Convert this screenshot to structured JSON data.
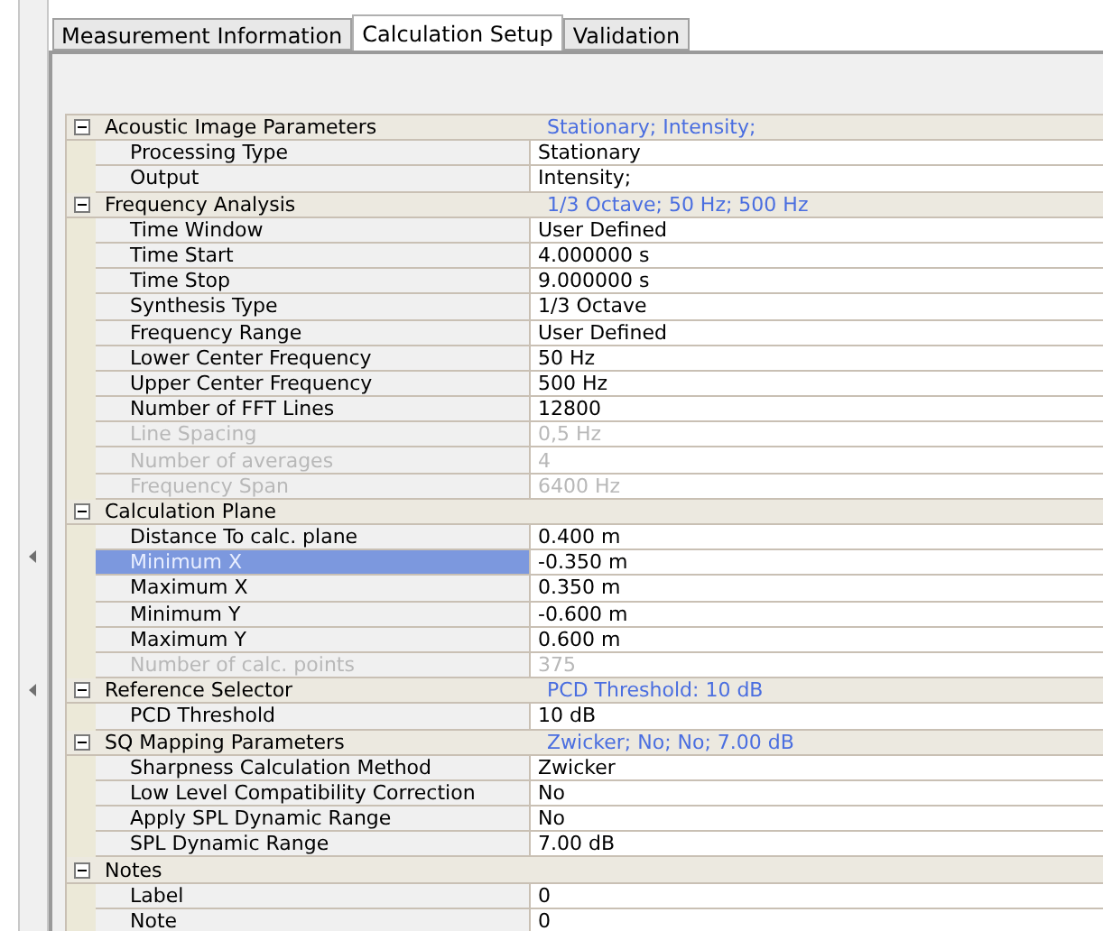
{
  "tabs": [
    {
      "label": "Measurement Information",
      "selected": false
    },
    {
      "label": "Calculation Setup",
      "selected": true
    },
    {
      "label": "Validation",
      "selected": false
    }
  ],
  "groups": [
    {
      "name": "Acoustic Image Parameters",
      "summary": "Stationary; Intensity;",
      "expanded": true,
      "properties": [
        {
          "label": "Processing Type",
          "value": "Stationary",
          "disabled": false,
          "selected": false
        },
        {
          "label": "Output",
          "value": "Intensity;",
          "disabled": false,
          "selected": false
        }
      ]
    },
    {
      "name": "Frequency Analysis",
      "summary": "1/3 Octave; 50 Hz; 500 Hz",
      "expanded": true,
      "properties": [
        {
          "label": "Time Window",
          "value": "User Defined",
          "disabled": false,
          "selected": false
        },
        {
          "label": "Time Start",
          "value": "4.000000 s",
          "disabled": false,
          "selected": false
        },
        {
          "label": "Time Stop",
          "value": "9.000000 s",
          "disabled": false,
          "selected": false
        },
        {
          "label": "Synthesis Type",
          "value": "1/3 Octave",
          "disabled": false,
          "selected": false
        },
        {
          "label": "Frequency Range",
          "value": "User Defined",
          "disabled": false,
          "selected": false
        },
        {
          "label": "Lower Center Frequency",
          "value": "50 Hz",
          "disabled": false,
          "selected": false
        },
        {
          "label": "Upper Center Frequency",
          "value": "500 Hz",
          "disabled": false,
          "selected": false
        },
        {
          "label": "Number of FFT Lines",
          "value": "12800",
          "disabled": false,
          "selected": false
        },
        {
          "label": "Line Spacing",
          "value": "0,5 Hz",
          "disabled": true,
          "selected": false
        },
        {
          "label": "Number of averages",
          "value": "4",
          "disabled": true,
          "selected": false
        },
        {
          "label": "Frequency Span",
          "value": "6400 Hz",
          "disabled": true,
          "selected": false
        }
      ]
    },
    {
      "name": "Calculation Plane",
      "expanded": true,
      "properties": [
        {
          "label": "Distance To calc. plane",
          "value": "0.400 m",
          "disabled": false,
          "selected": false
        },
        {
          "label": "Minimum X",
          "value": "-0.350 m",
          "disabled": false,
          "selected": true
        },
        {
          "label": "Maximum X",
          "value": "0.350 m",
          "disabled": false,
          "selected": false
        },
        {
          "label": "Minimum Y",
          "value": "-0.600 m",
          "disabled": false,
          "selected": false
        },
        {
          "label": "Maximum Y",
          "value": "0.600 m",
          "disabled": false,
          "selected": false
        },
        {
          "label": "Number of calc. points",
          "value": "375",
          "disabled": true,
          "selected": false
        }
      ]
    },
    {
      "name": "Reference Selector",
      "summary": "PCD Threshold: 10 dB",
      "expanded": true,
      "properties": [
        {
          "label": "PCD Threshold",
          "value": "10 dB",
          "disabled": false,
          "selected": false
        }
      ]
    },
    {
      "name": "SQ Mapping Parameters",
      "summary": "Zwicker; No; No; 7.00 dB",
      "expanded": true,
      "properties": [
        {
          "label": "Sharpness Calculation Method",
          "value": "Zwicker",
          "disabled": false,
          "selected": false
        },
        {
          "label": "Low Level Compatibility Correction",
          "value": "No",
          "disabled": false,
          "selected": false
        },
        {
          "label": "Apply SPL Dynamic Range",
          "value": "No",
          "disabled": false,
          "selected": false
        },
        {
          "label": "SPL Dynamic Range",
          "value": "7.00 dB",
          "disabled": false,
          "selected": false
        }
      ]
    },
    {
      "name": "Notes",
      "expanded": true,
      "properties": [
        {
          "label": "Label",
          "value": "0",
          "disabled": false,
          "selected": false
        },
        {
          "label": "Note",
          "value": "0",
          "disabled": false,
          "selected": false
        }
      ]
    }
  ]
}
